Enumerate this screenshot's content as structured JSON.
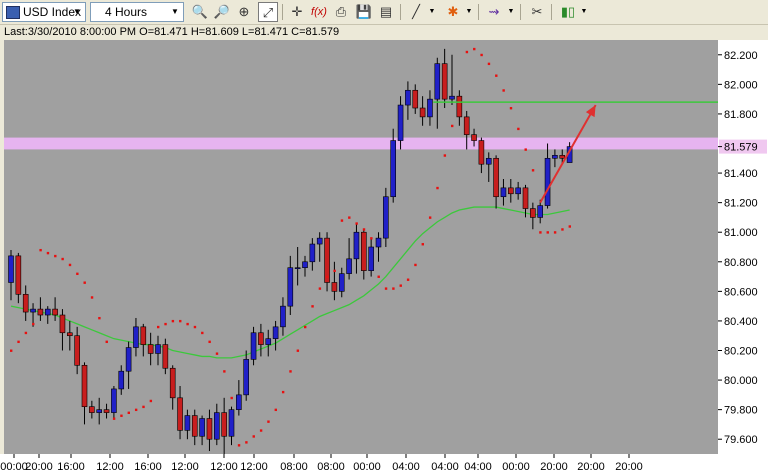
{
  "toolbar": {
    "symbol": "USD Index",
    "timeframe": "4 Hours",
    "icons": [
      "flag-icon",
      "zoom-in-icon",
      "zoom-out-icon",
      "zoom-reset-icon",
      "auto-scale-icon",
      "crosshair-icon",
      "formula-icon",
      "print-icon",
      "save-icon",
      "properties-icon",
      "line-tool-icon",
      "fibonacci-tool-icon",
      "indicators-icon",
      "settings-icon",
      "candles-icon"
    ],
    "fx_label": "f(x)"
  },
  "status_line": "Last:3/30/2010 8:00:00 PM O=81.471 H=81.609 L=81.471 C=81.579",
  "chart_data": {
    "type": "candlestick",
    "ylim": [
      79.5,
      82.3
    ],
    "y_ticks": [
      "82.200",
      "82.000",
      "81.800",
      "81.579",
      "81.400",
      "81.200",
      "81.000",
      "80.800",
      "80.600",
      "80.400",
      "80.200",
      "80.000",
      "79.800",
      "79.600"
    ],
    "x_tick_labels": [
      "00:00",
      "20:00",
      "16:00",
      "12:00",
      "16:00",
      "12:00",
      "12:00",
      "12:00",
      "08:00",
      "08:00",
      "00:00",
      "04:00",
      "04:00",
      "04:00",
      "00:00",
      "20:00",
      "20:00",
      "20:00"
    ],
    "current_price": "81.579",
    "colors": {
      "background": "#a0a0a0",
      "bull": "#2020c8",
      "bear": "#c81e1e",
      "moving_average": "#3cc83c",
      "parabolic_sar": "#e81010",
      "horizontal_band": "#e6b4f0",
      "support_line": "#3cc83c",
      "price_label_bg": "#f0c8f0"
    },
    "candles": [
      {
        "o": 80.66,
        "h": 80.88,
        "l": 80.54,
        "c": 80.84
      },
      {
        "o": 80.84,
        "h": 80.86,
        "l": 80.52,
        "c": 80.58
      },
      {
        "o": 80.58,
        "h": 80.64,
        "l": 80.4,
        "c": 80.46
      },
      {
        "o": 80.46,
        "h": 80.52,
        "l": 80.36,
        "c": 80.48
      },
      {
        "o": 80.48,
        "h": 80.56,
        "l": 80.4,
        "c": 80.44
      },
      {
        "o": 80.44,
        "h": 80.5,
        "l": 80.38,
        "c": 80.48
      },
      {
        "o": 80.48,
        "h": 80.56,
        "l": 80.4,
        "c": 80.44
      },
      {
        "o": 80.44,
        "h": 80.48,
        "l": 80.2,
        "c": 80.32
      },
      {
        "o": 80.32,
        "h": 80.4,
        "l": 80.2,
        "c": 80.3
      },
      {
        "o": 80.3,
        "h": 80.36,
        "l": 80.04,
        "c": 80.1
      },
      {
        "o": 80.1,
        "h": 80.12,
        "l": 79.7,
        "c": 79.82
      },
      {
        "o": 79.82,
        "h": 79.86,
        "l": 79.74,
        "c": 79.78
      },
      {
        "o": 79.78,
        "h": 79.88,
        "l": 79.7,
        "c": 79.8
      },
      {
        "o": 79.8,
        "h": 79.84,
        "l": 79.74,
        "c": 79.78
      },
      {
        "o": 79.78,
        "h": 79.96,
        "l": 79.74,
        "c": 79.94
      },
      {
        "o": 79.94,
        "h": 80.1,
        "l": 79.9,
        "c": 80.06
      },
      {
        "o": 80.06,
        "h": 80.26,
        "l": 79.94,
        "c": 80.22
      },
      {
        "o": 80.22,
        "h": 80.42,
        "l": 80.16,
        "c": 80.36
      },
      {
        "o": 80.36,
        "h": 80.38,
        "l": 80.16,
        "c": 80.24
      },
      {
        "o": 80.24,
        "h": 80.32,
        "l": 80.1,
        "c": 80.18
      },
      {
        "o": 80.18,
        "h": 80.3,
        "l": 80.1,
        "c": 80.24
      },
      {
        "o": 80.24,
        "h": 80.28,
        "l": 80.04,
        "c": 80.08
      },
      {
        "o": 80.08,
        "h": 80.1,
        "l": 79.8,
        "c": 79.88
      },
      {
        "o": 79.88,
        "h": 79.96,
        "l": 79.6,
        "c": 79.66
      },
      {
        "o": 79.66,
        "h": 79.8,
        "l": 79.6,
        "c": 79.76
      },
      {
        "o": 79.76,
        "h": 79.8,
        "l": 79.56,
        "c": 79.62
      },
      {
        "o": 79.62,
        "h": 79.76,
        "l": 79.56,
        "c": 79.74
      },
      {
        "o": 79.74,
        "h": 79.8,
        "l": 79.52,
        "c": 79.6
      },
      {
        "o": 79.6,
        "h": 79.84,
        "l": 79.56,
        "c": 79.78
      },
      {
        "o": 79.78,
        "h": 79.88,
        "l": 79.5,
        "c": 79.62
      },
      {
        "o": 79.62,
        "h": 79.82,
        "l": 79.56,
        "c": 79.8
      },
      {
        "o": 79.8,
        "h": 80.0,
        "l": 79.76,
        "c": 79.9
      },
      {
        "o": 79.9,
        "h": 80.2,
        "l": 79.86,
        "c": 80.14
      },
      {
        "o": 80.14,
        "h": 80.36,
        "l": 80.1,
        "c": 80.32
      },
      {
        "o": 80.32,
        "h": 80.38,
        "l": 80.16,
        "c": 80.24
      },
      {
        "o": 80.24,
        "h": 80.34,
        "l": 80.16,
        "c": 80.28
      },
      {
        "o": 80.28,
        "h": 80.4,
        "l": 80.2,
        "c": 80.36
      },
      {
        "o": 80.36,
        "h": 80.56,
        "l": 80.3,
        "c": 80.5
      },
      {
        "o": 80.5,
        "h": 80.84,
        "l": 80.44,
        "c": 80.76
      },
      {
        "o": 80.76,
        "h": 80.9,
        "l": 80.64,
        "c": 80.76
      },
      {
        "o": 80.76,
        "h": 80.84,
        "l": 80.7,
        "c": 80.8
      },
      {
        "o": 80.8,
        "h": 80.96,
        "l": 80.74,
        "c": 80.92
      },
      {
        "o": 80.92,
        "h": 81.0,
        "l": 80.8,
        "c": 80.96
      },
      {
        "o": 80.96,
        "h": 81.0,
        "l": 80.6,
        "c": 80.66
      },
      {
        "o": 80.66,
        "h": 80.8,
        "l": 80.54,
        "c": 80.6
      },
      {
        "o": 80.6,
        "h": 80.76,
        "l": 80.56,
        "c": 80.72
      },
      {
        "o": 80.72,
        "h": 80.96,
        "l": 80.68,
        "c": 80.82
      },
      {
        "o": 80.82,
        "h": 81.06,
        "l": 80.72,
        "c": 81.0
      },
      {
        "o": 81.0,
        "h": 81.02,
        "l": 80.68,
        "c": 80.74
      },
      {
        "o": 80.74,
        "h": 80.96,
        "l": 80.7,
        "c": 80.9
      },
      {
        "o": 80.9,
        "h": 81.0,
        "l": 80.8,
        "c": 80.96
      },
      {
        "o": 80.96,
        "h": 81.3,
        "l": 80.9,
        "c": 81.24
      },
      {
        "o": 81.24,
        "h": 81.7,
        "l": 81.2,
        "c": 81.62
      },
      {
        "o": 81.62,
        "h": 81.92,
        "l": 81.56,
        "c": 81.86
      },
      {
        "o": 81.86,
        "h": 82.02,
        "l": 81.76,
        "c": 81.96
      },
      {
        "o": 81.96,
        "h": 82.0,
        "l": 81.8,
        "c": 81.84
      },
      {
        "o": 81.84,
        "h": 81.92,
        "l": 81.72,
        "c": 81.78
      },
      {
        "o": 81.78,
        "h": 81.96,
        "l": 81.72,
        "c": 81.9
      },
      {
        "o": 81.9,
        "h": 82.18,
        "l": 81.7,
        "c": 82.14
      },
      {
        "o": 82.14,
        "h": 82.24,
        "l": 81.84,
        "c": 81.9
      },
      {
        "o": 81.9,
        "h": 82.2,
        "l": 81.86,
        "c": 81.92
      },
      {
        "o": 81.92,
        "h": 81.96,
        "l": 81.72,
        "c": 81.78
      },
      {
        "o": 81.78,
        "h": 81.82,
        "l": 81.56,
        "c": 81.66
      },
      {
        "o": 81.66,
        "h": 81.7,
        "l": 81.58,
        "c": 81.62
      },
      {
        "o": 81.62,
        "h": 81.64,
        "l": 81.4,
        "c": 81.46
      },
      {
        "o": 81.46,
        "h": 81.54,
        "l": 81.34,
        "c": 81.5
      },
      {
        "o": 81.5,
        "h": 81.52,
        "l": 81.16,
        "c": 81.24
      },
      {
        "o": 81.24,
        "h": 81.36,
        "l": 81.18,
        "c": 81.3
      },
      {
        "o": 81.3,
        "h": 81.36,
        "l": 81.2,
        "c": 81.26
      },
      {
        "o": 81.26,
        "h": 81.34,
        "l": 81.22,
        "c": 81.3
      },
      {
        "o": 81.3,
        "h": 81.32,
        "l": 81.1,
        "c": 81.16
      },
      {
        "o": 81.16,
        "h": 81.2,
        "l": 81.02,
        "c": 81.1
      },
      {
        "o": 81.1,
        "h": 81.22,
        "l": 81.06,
        "c": 81.18
      },
      {
        "o": 81.18,
        "h": 81.6,
        "l": 81.16,
        "c": 81.5
      },
      {
        "o": 81.5,
        "h": 81.56,
        "l": 81.44,
        "c": 81.52
      },
      {
        "o": 81.52,
        "h": 81.56,
        "l": 81.46,
        "c": 81.5
      },
      {
        "o": 81.471,
        "h": 81.609,
        "l": 81.471,
        "c": 81.579
      }
    ],
    "moving_average": [
      80.5,
      80.49,
      80.48,
      80.47,
      80.46,
      80.45,
      80.44,
      80.42,
      80.4,
      80.38,
      80.36,
      80.34,
      80.32,
      80.3,
      80.28,
      80.27,
      80.26,
      80.25,
      80.24,
      80.24,
      80.23,
      80.22,
      80.2,
      80.19,
      80.18,
      80.17,
      80.16,
      80.16,
      80.15,
      80.15,
      80.15,
      80.16,
      80.17,
      80.19,
      80.21,
      80.23,
      80.25,
      80.28,
      80.31,
      80.34,
      80.37,
      80.4,
      80.43,
      80.45,
      80.47,
      80.49,
      80.51,
      80.54,
      80.57,
      80.61,
      80.65,
      80.7,
      80.76,
      80.82,
      80.88,
      80.94,
      80.99,
      81.03,
      81.07,
      81.1,
      81.13,
      81.15,
      81.16,
      81.17,
      81.17,
      81.17,
      81.17,
      81.16,
      81.15,
      81.14,
      81.13,
      81.12,
      81.12,
      81.12,
      81.13,
      81.14,
      81.15
    ],
    "parabolic_sar": [
      80.2,
      80.26,
      80.32,
      80.38,
      80.88,
      80.86,
      80.84,
      80.82,
      80.78,
      80.72,
      80.66,
      80.56,
      80.42,
      80.26,
      79.74,
      79.76,
      79.78,
      79.8,
      79.82,
      79.86,
      80.36,
      80.38,
      80.4,
      80.4,
      80.38,
      80.36,
      80.32,
      80.26,
      80.18,
      80.06,
      79.88,
      79.56,
      79.58,
      79.62,
      79.66,
      79.72,
      79.8,
      79.92,
      80.06,
      80.2,
      80.36,
      80.5,
      80.62,
      80.7,
      80.74,
      81.08,
      81.1,
      81.06,
      81.02,
      80.96,
      80.7,
      80.62,
      80.62,
      80.64,
      80.68,
      80.78,
      80.92,
      81.1,
      81.3,
      81.52,
      81.72,
      81.88,
      82.22,
      82.24,
      82.2,
      82.14,
      82.06,
      81.96,
      81.84,
      81.7,
      81.56,
      81.42,
      81.0,
      81.0,
      81.0,
      81.02,
      81.04
    ],
    "band_price": [
      81.58,
      81.62
    ],
    "support_line_price": 81.88,
    "arrow": {
      "from_index": 72,
      "from_price": 81.2,
      "to_index": 79,
      "to_price": 81.86
    }
  }
}
